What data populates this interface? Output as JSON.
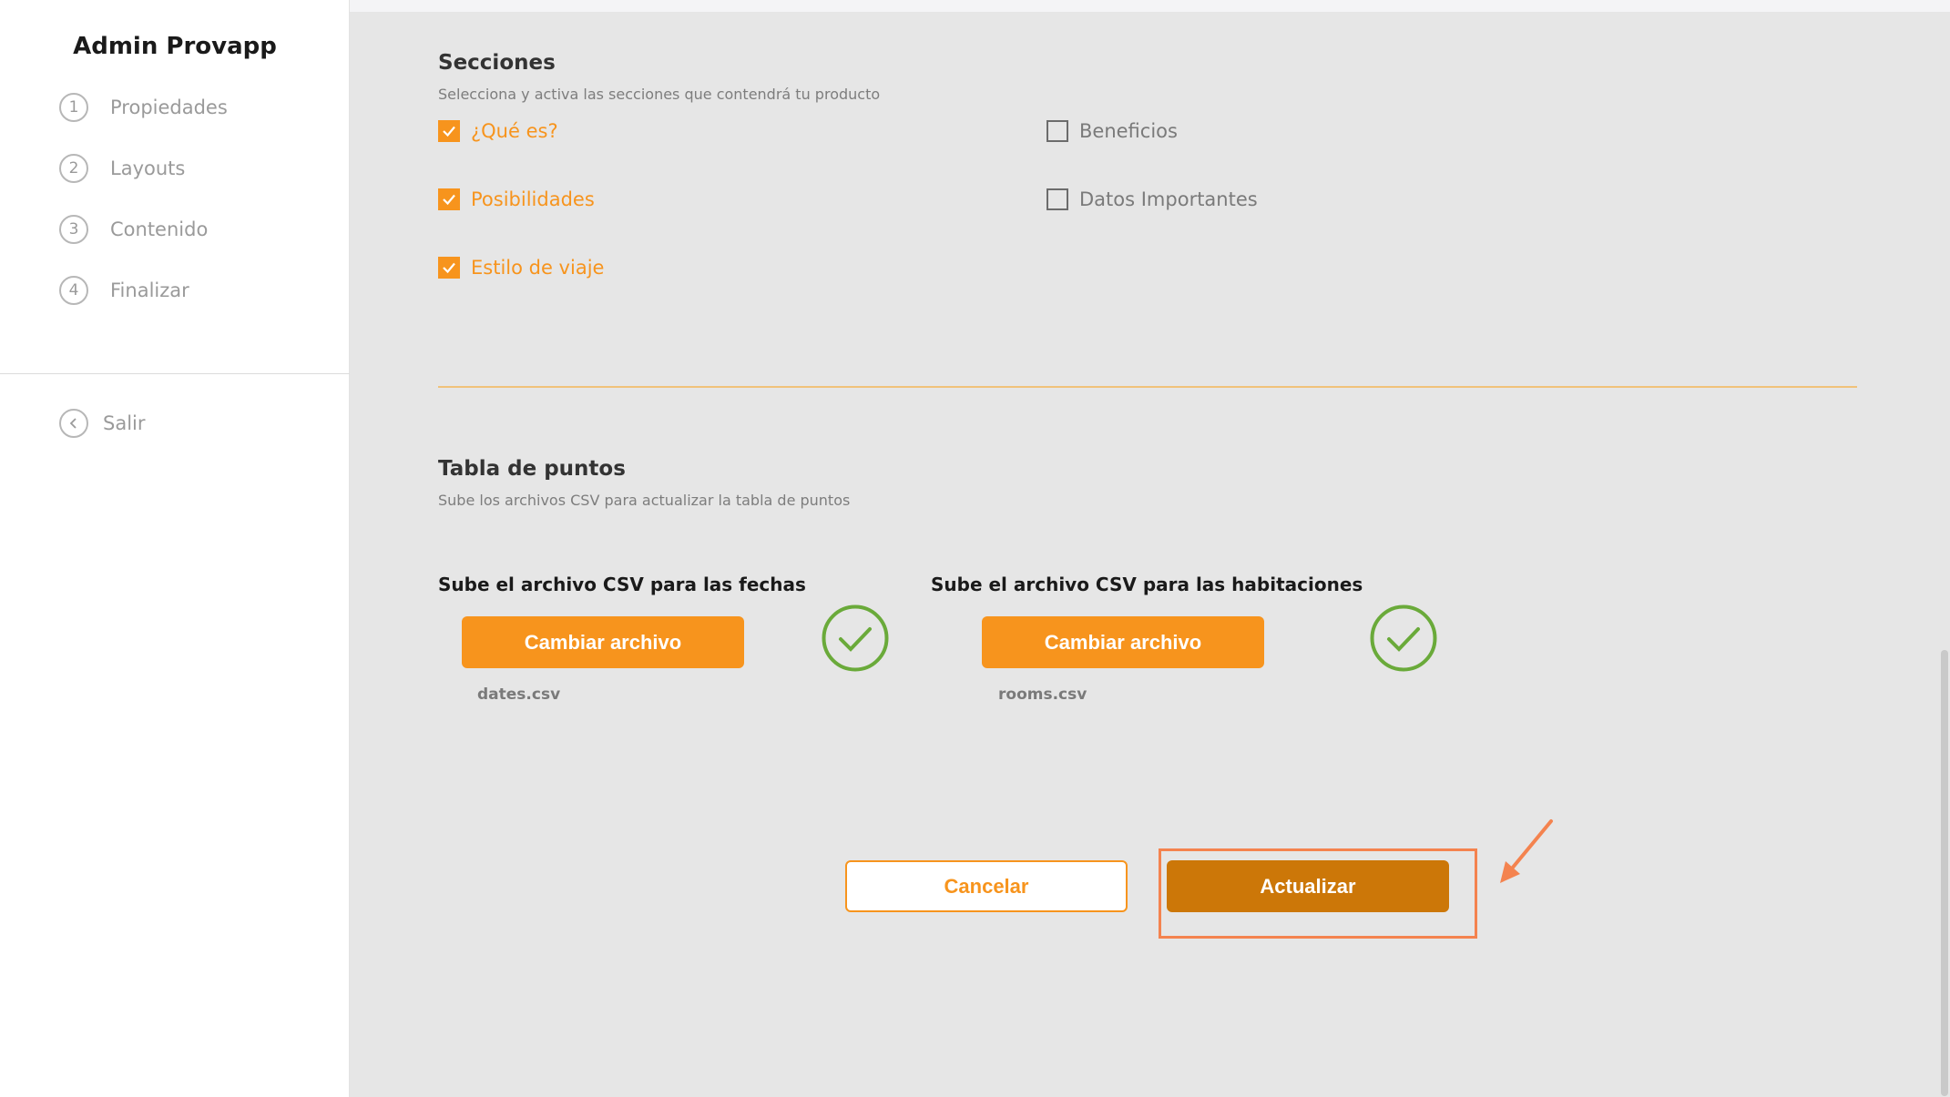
{
  "sidebar": {
    "brand": "Admin Provapp",
    "steps": [
      {
        "num": "1",
        "label": "Propiedades"
      },
      {
        "num": "2",
        "label": "Layouts"
      },
      {
        "num": "3",
        "label": "Contenido"
      },
      {
        "num": "4",
        "label": "Finalizar"
      }
    ],
    "logout_label": "Salir",
    "logout_icon": "chevron-left-circle-icon"
  },
  "sections": {
    "title": "Secciones",
    "subtitle": "Selecciona y activa las secciones que contendrá tu producto",
    "options": [
      {
        "label": "¿Qué es?",
        "checked": true
      },
      {
        "label": "Beneficios",
        "checked": false
      },
      {
        "label": "Posibilidades",
        "checked": true
      },
      {
        "label": "Datos Importantes",
        "checked": false
      },
      {
        "label": "Estilo de viaje",
        "checked": true
      }
    ]
  },
  "points_table": {
    "title": "Tabla de puntos",
    "subtitle": "Sube los archivos CSV para actualizar la tabla de puntos",
    "uploads": [
      {
        "title": "Sube el archivo CSV para las fechas",
        "button_label": "Cambiar archivo",
        "file_name": "dates.csv",
        "status_icon": "check-circle-icon"
      },
      {
        "title": "Sube el archivo CSV para las habitaciones",
        "button_label": "Cambiar archivo",
        "file_name": "rooms.csv",
        "status_icon": "check-circle-icon"
      }
    ]
  },
  "actions": {
    "cancel_label": "Cancelar",
    "update_label": "Actualizar"
  },
  "colors": {
    "accent": "#f7941d",
    "update_button": "#cc7708",
    "success": "#6aaa3a",
    "highlight": "#f4834f",
    "main_bg": "#e6e6e6"
  }
}
